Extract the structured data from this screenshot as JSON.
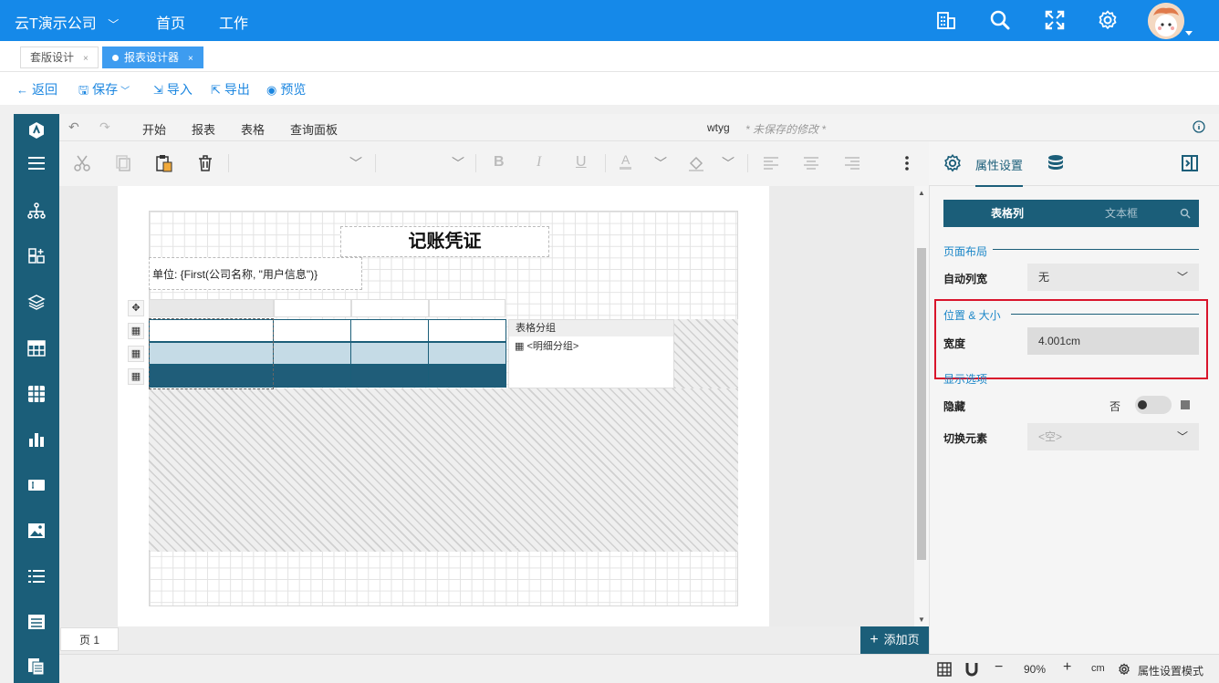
{
  "topbar": {
    "company": "云T演示公司",
    "nav": [
      "首页",
      "工作"
    ],
    "icons": [
      "building-icon",
      "search-icon",
      "fullscreen-icon",
      "gear-icon"
    ]
  },
  "tabs": [
    {
      "label": "套版设计",
      "close": "×"
    },
    {
      "label": "报表设计器",
      "close": "×"
    }
  ],
  "actions": [
    {
      "icon": "←",
      "label": "返回"
    },
    {
      "icon": "🖫",
      "label": "保存"
    },
    {
      "icon": "⇲",
      "label": "导入"
    },
    {
      "icon": "⇱",
      "label": "导出"
    },
    {
      "icon": "◉",
      "label": "预览"
    }
  ],
  "ribbon": {
    "tabs": [
      "开始",
      "报表",
      "表格",
      "查询面板"
    ],
    "doc_name": "wtyg",
    "unsaved": "* 未保存的修改 *"
  },
  "report": {
    "title": "记账凭证",
    "unit": "单位: {First(公司名称, \"用户信息\")}",
    "group_header": "表格分组",
    "group_item": "<明细分组>"
  },
  "pagebar": {
    "page_tab": "页 1",
    "add_page": "添加页"
  },
  "status": {
    "zoom_minus": "−",
    "zoom": "90%",
    "zoom_plus": "+",
    "unit": "cm",
    "mode": "属性设置模式"
  },
  "panel": {
    "tab_props": "属性设置",
    "seg_left": "表格列",
    "seg_right": "文本框",
    "section_layout": "页面布局",
    "auto_width_label": "自动列宽",
    "auto_width_value": "无",
    "section_pos": "位置 & 大小",
    "width_label": "宽度",
    "width_value": "4.001cm",
    "section_display": "显示选项",
    "hide_label": "隐藏",
    "hide_value": "否",
    "switch_label": "切换元素",
    "switch_placeholder": "<空>"
  },
  "colors": {
    "topbar": "#1589e9",
    "sidebar": "#1b5e79",
    "accent": "#1b86e0",
    "highlight": "#d9142b",
    "row_mid": "#c5dbe6",
    "row_dark": "#1f5d79"
  }
}
